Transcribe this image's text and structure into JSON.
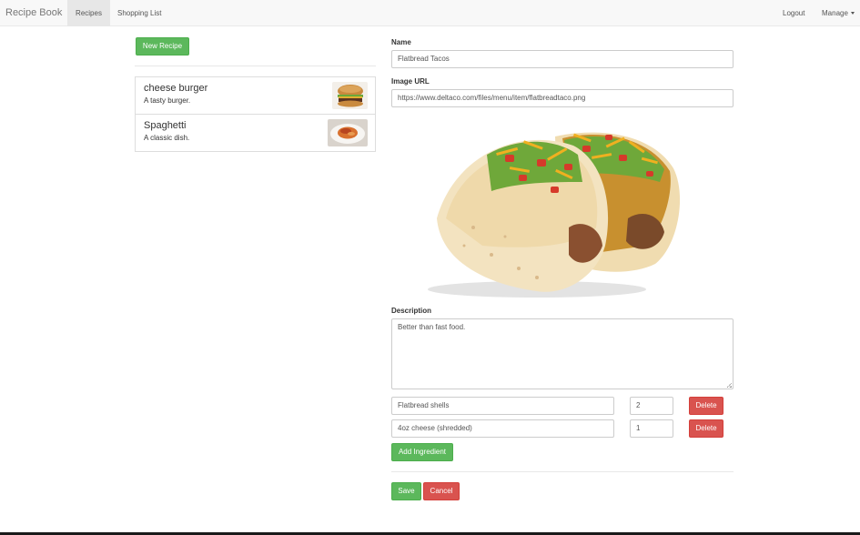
{
  "navbar": {
    "brand": "Recipe Book",
    "recipes": "Recipes",
    "shopping_list": "Shopping List",
    "logout": "Logout",
    "manage": "Manage"
  },
  "sidebar": {
    "new_recipe": "New Recipe",
    "recipes": [
      {
        "name": "cheese burger",
        "description": "A tasty burger."
      },
      {
        "name": "Spaghetti",
        "description": "A classic dish."
      }
    ]
  },
  "form": {
    "name_label": "Name",
    "name_value": "Flatbread Tacos",
    "image_url_label": "Image URL",
    "image_url_value": "https://www.deltaco.com/files/menu/item/flatbreadtaco.png",
    "description_label": "Description",
    "description_value": "Better than fast food.",
    "ingredients": [
      {
        "name": "Flatbread shells",
        "amount": "2",
        "delete": "Delete"
      },
      {
        "name": "4oz cheese (shredded)",
        "amount": "1",
        "delete": "Delete"
      }
    ],
    "add_ingredient": "Add Ingredient",
    "save": "Save",
    "cancel": "Cancel"
  },
  "colors": {
    "success": "#5cb85c",
    "danger": "#d9534f",
    "navbar_bg": "#f8f8f8"
  }
}
